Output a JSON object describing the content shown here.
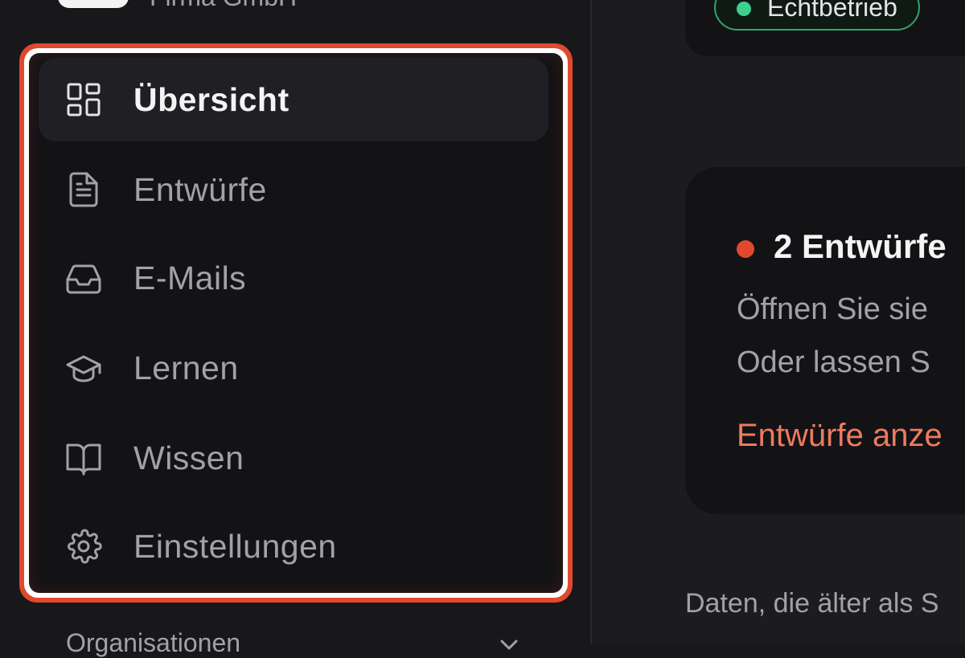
{
  "workspace": {
    "name": "Firma GmbH"
  },
  "nav": {
    "items": [
      {
        "label": "Übersicht",
        "icon": "dashboard-icon",
        "active": true
      },
      {
        "label": "Entwürfe",
        "icon": "document-icon",
        "active": false
      },
      {
        "label": "E-Mails",
        "icon": "inbox-icon",
        "active": false
      },
      {
        "label": "Lernen",
        "icon": "graduation-cap-icon",
        "active": false
      },
      {
        "label": "Wissen",
        "icon": "book-icon",
        "active": false
      },
      {
        "label": "Einstellungen",
        "icon": "gear-icon",
        "active": false
      }
    ],
    "highlight_color": "#e0492d"
  },
  "organizations": {
    "label": "Organisationen"
  },
  "status": {
    "label": "Echtbetrieb",
    "color": "#3ecf8e"
  },
  "drafts_card": {
    "title": "2 Entwürfe",
    "line1": "Öffnen Sie sie",
    "line2": "Oder lassen S",
    "link": "Entwürfe anze",
    "accent": "#e0492d"
  },
  "footer": {
    "note": "Daten, die älter als S"
  }
}
